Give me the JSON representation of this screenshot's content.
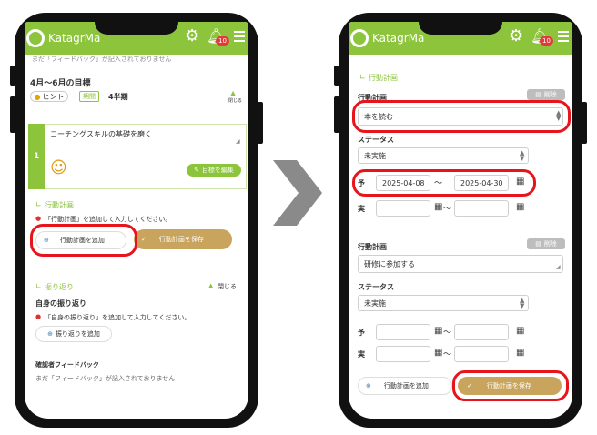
{
  "app": {
    "name": "KatagrMa",
    "notif_count": "10"
  },
  "left": {
    "cut_text": "まだ「フィードバック」が記入されておりません",
    "goal_title": "4月〜6月の目標",
    "hint_label": "ヒント",
    "period_label": "期間",
    "quarter_label": "4半期",
    "close_label": "閉じる",
    "goal_number": "1",
    "goal_text": "コーチングスキルの基礎を磨く",
    "edit_goal_label": "目標を編集",
    "action_plan_title": "行動計画",
    "action_plan_warning": "「行動計画」を追加して入力してください。",
    "add_plan_label": "行動計画を追加",
    "save_plan_label": "行動計画を保存",
    "reflection_title": "振り返り",
    "reflection_close": "閉じる",
    "self_reflection_title": "自身の振り返り",
    "self_reflection_warning": "「自身の振り返り」を追加して入力してください。",
    "add_reflection_label": "振り返りを追加",
    "reviewer_fb_title": "確認者フィードバック",
    "reviewer_fb_text": "まだ「フィードバック」が記入されておりません"
  },
  "right": {
    "section_title": "行動計画",
    "plan1": {
      "label": "行動計画",
      "delete_label": "削除",
      "value": "本を読む",
      "status_label": "ステータス",
      "status_value": "未実施",
      "plan_label": "予",
      "plan_start": "2025-04-08",
      "plan_end": "2025-04-30",
      "actual_label": "実",
      "actual_start": "",
      "actual_end": ""
    },
    "plan2": {
      "label": "行動計画",
      "delete_label": "削除",
      "value": "研修に参加する",
      "status_label": "ステータス",
      "status_value": "未実施",
      "plan_label": "予",
      "plan_start": "",
      "plan_end": "",
      "actual_label": "実",
      "actual_start": "",
      "actual_end": ""
    },
    "tilde": "〜",
    "add_plan_label": "行動計画を追加",
    "save_plan_label": "行動計画を保存"
  },
  "colors": {
    "brand_green": "#8cc43c",
    "save_brown": "#c9a45c",
    "highlight_red": "#e8141c",
    "arrow_gray": "#8a8a8a"
  }
}
